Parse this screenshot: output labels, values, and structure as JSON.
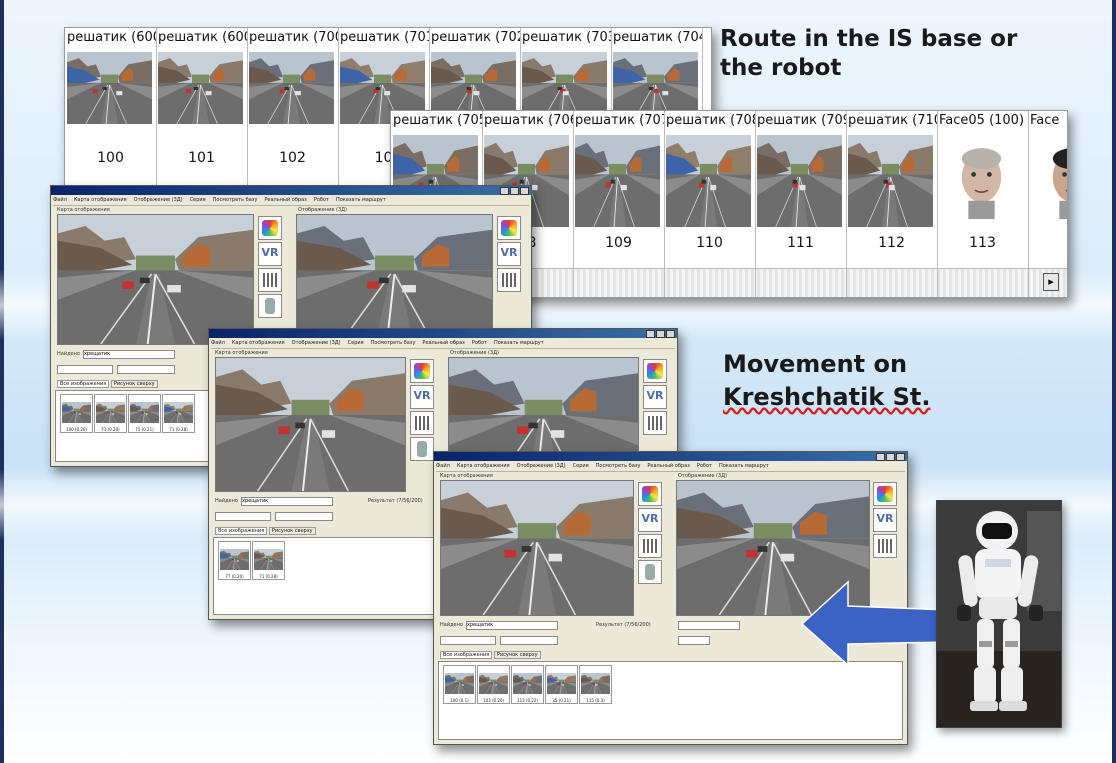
{
  "captions": {
    "route_line1": "Route in the IS base or",
    "route_line2": "the robot",
    "movement_line1": "Movement on",
    "movement_line2": "Kreshchatik St."
  },
  "strip_top": {
    "cells": [
      {
        "label": "решатик (600",
        "number": "100"
      },
      {
        "label": "решатик (600",
        "number": "101"
      },
      {
        "label": "решатик (700",
        "number": "102"
      },
      {
        "label": "решатик (701",
        "number": "10"
      },
      {
        "label": "решатик (702",
        "number": ""
      },
      {
        "label": "решатик (703",
        "number": ""
      },
      {
        "label": "решатик (704",
        "number": ""
      }
    ]
  },
  "strip_bottom": {
    "cells": [
      {
        "label": "решатик (705",
        "number": ""
      },
      {
        "label": "решатик (706",
        "number": "08"
      },
      {
        "label": "решатик (707",
        "number": "109"
      },
      {
        "label": "решатик (708",
        "number": "110"
      },
      {
        "label": "решатик (709",
        "number": "111"
      },
      {
        "label": "решатик (710",
        "number": "112"
      },
      {
        "label": "Face05 (100)",
        "number": "113"
      },
      {
        "label": "Face",
        "number": ""
      }
    ],
    "scroll_icon": "arrow-right-icon"
  },
  "window": {
    "menu_items": [
      "Файл",
      "Карта отображения",
      "Отображение (3Д)",
      "Серия",
      "Посмотреть базу",
      "Реальный образ",
      "Робот",
      "Показать маршрут"
    ],
    "left_view_label": "Карта отображения",
    "right_view_label": "Отображение (3Д)",
    "name_label": "Найдено",
    "name_value": "хрещатик",
    "result_label": "Результат",
    "result_value": "(7/56/200)",
    "tabs": [
      "Все изображения",
      "Рисунок сверху"
    ],
    "thumb_labels_a": [
      "100 (0.20)",
      "71 (0.20)",
      "75 (0.21)",
      "71 (0.28)"
    ],
    "thumb_labels_b": [
      "77 (0.20)",
      "71 (0.28)"
    ],
    "thumb_labels_c": [
      "100 (0.1)",
      "103 (0.20)",
      "113 (0.22)",
      "35 (0.21)",
      "115 (0.3)"
    ],
    "tool_icons": [
      "rgb-color-icon",
      "vr-icon",
      "image-grid-icon",
      "robot-icon"
    ],
    "vr_text": "VR"
  },
  "colors": {
    "slide_border": "#1d2f60",
    "arrow_fill": "#3a63c4",
    "title_bar": "#0a246a",
    "window_bg": "#ece9d8"
  }
}
